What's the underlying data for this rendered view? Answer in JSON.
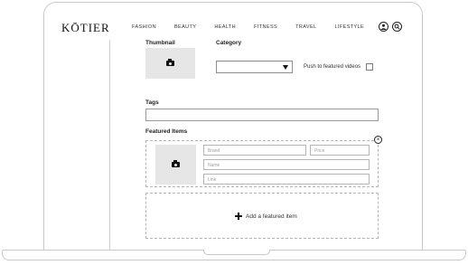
{
  "header": {
    "logo": "KŌTIER",
    "nav": [
      "FASHION",
      "BEAUTY",
      "HEALTH",
      "FITNESS",
      "TRAVEL",
      "LIFESTYLE"
    ],
    "icons": [
      "user-icon",
      "search-icon"
    ]
  },
  "form": {
    "thumbnail_label": "Thumbnail",
    "category_label": "Category",
    "category_value": "",
    "push_label": "Push to featured videos",
    "push_checked": false,
    "tags_label": "Tags",
    "tags_value": "",
    "featured_label": "Featured Items",
    "brand_placeholder": "Brand",
    "price_placeholder": "Price",
    "name_placeholder": "Name",
    "link_placeholder": "Link",
    "add_label": "Add a featured item"
  }
}
